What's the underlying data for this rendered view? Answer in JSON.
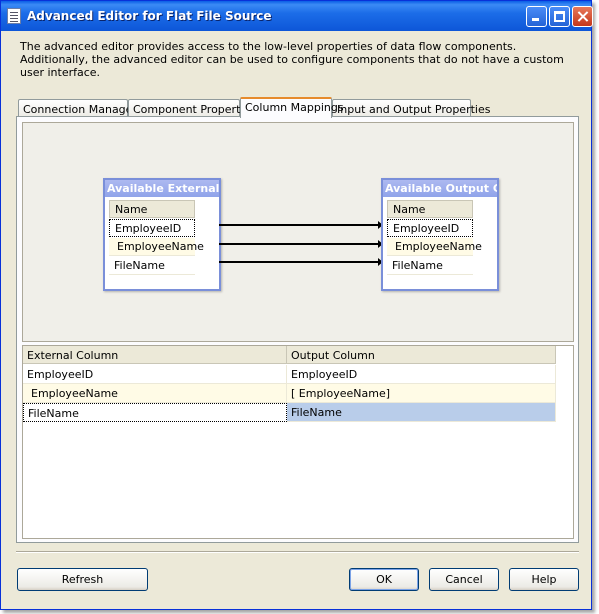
{
  "window": {
    "title": "Advanced Editor for Flat File Source",
    "title_icon": "document-icon"
  },
  "description": "The advanced editor provides access to the low-level properties of data flow components. Additionally, the advanced editor can be used to configure components that do not have a custom user interface.",
  "tabs": [
    {
      "label": "Connection Managers",
      "active": false
    },
    {
      "label": "Component Properties",
      "active": false
    },
    {
      "label": "Column Mappings",
      "active": true
    },
    {
      "label": "Input and Output Properties",
      "active": false
    }
  ],
  "mapping": {
    "left_box": {
      "title": "Available External ...",
      "header": "Name",
      "rows": [
        "EmployeeID",
        "EmployeeName",
        "FileName"
      ]
    },
    "right_box": {
      "title": "Available Output C...",
      "header": "Name",
      "rows": [
        "EmployeeID",
        "EmployeeName",
        "FileName"
      ]
    }
  },
  "grid": {
    "columns": [
      "External Column",
      "Output Column"
    ],
    "rows": [
      [
        "EmployeeID",
        "EmployeeID"
      ],
      [
        "EmployeeName",
        "[ EmployeeName]"
      ],
      [
        "FileName",
        "FileName"
      ]
    ]
  },
  "buttons": {
    "refresh": "Refresh",
    "ok": "OK",
    "cancel": "Cancel",
    "help": "Help"
  },
  "colors": {
    "titlebar": "#0a5ee6",
    "active_tab_accent": "#e68b2c",
    "selection": "#b9cdea"
  }
}
